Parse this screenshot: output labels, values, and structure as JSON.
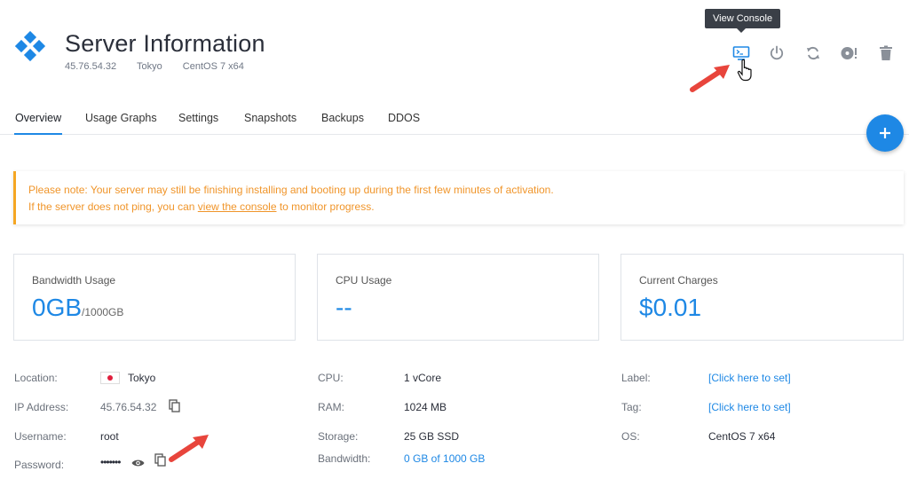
{
  "header": {
    "title": "Server Information",
    "ip": "45.76.54.32",
    "location": "Tokyo",
    "os": "CentOS 7 x64"
  },
  "actions": {
    "tooltip": "View Console",
    "icons": [
      "console-icon",
      "power-icon",
      "restart-icon",
      "iso-icon",
      "trash-icon"
    ]
  },
  "tabs": [
    {
      "label": "Overview",
      "active": true
    },
    {
      "label": "Usage Graphs"
    },
    {
      "label": "Settings"
    },
    {
      "label": "Snapshots"
    },
    {
      "label": "Backups"
    },
    {
      "label": "DDOS"
    }
  ],
  "notice": {
    "line1": "Please note: Your server may still be finishing installing and booting up during the first few minutes of activation.",
    "line2_pre": "If the server does not ping, you can ",
    "line2_link": "view the console",
    "line2_post": " to monitor progress."
  },
  "cards": {
    "bandwidth": {
      "title": "Bandwidth Usage",
      "value": "0GB",
      "suffix": "/1000GB"
    },
    "cpu": {
      "title": "CPU Usage",
      "value": "--"
    },
    "charges": {
      "title": "Current Charges",
      "value": "$0.01"
    }
  },
  "details": {
    "location_label": "Location:",
    "location_value": "Tokyo",
    "ip_label": "IP Address:",
    "ip_value": "45.76.54.32",
    "username_label": "Username:",
    "username_value": "root",
    "password_label": "Password:",
    "password_value": "•••••••",
    "cpu_label": "CPU:",
    "cpu_value": "1 vCore",
    "ram_label": "RAM:",
    "ram_value": "1024 MB",
    "storage_label": "Storage:",
    "storage_value": "25 GB SSD",
    "bandwidth_label": "Bandwidth:",
    "bandwidth_value": "0 GB of 1000 GB",
    "label_label": "Label:",
    "label_value": "[Click here to set]",
    "tag_label": "Tag:",
    "tag_value": "[Click here to set]",
    "os_label": "OS:",
    "os_value": "CentOS 7 x64"
  },
  "colors": {
    "accent": "#1e88e5",
    "warning": "#f5a623",
    "arrow": "#e8453c"
  }
}
